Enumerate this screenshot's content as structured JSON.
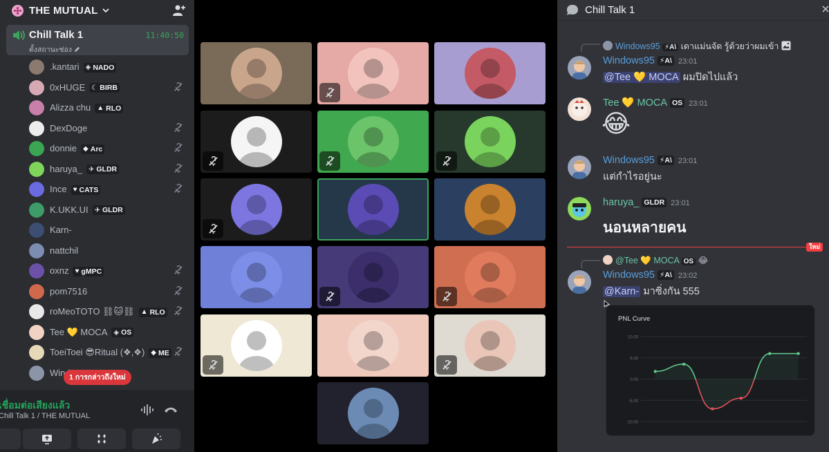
{
  "server": {
    "name": "THE MUTUAL"
  },
  "active_channel": {
    "name": "Chill Talk 1",
    "status": "ตั้งสถานะช่อง",
    "timer": "11:40:50"
  },
  "members": [
    {
      "name": ".kantari",
      "tag": "NADO",
      "glyph": "◈",
      "muted": false,
      "color": "#8a7a70"
    },
    {
      "name": "0xHUGE",
      "tag": "BIRB",
      "glyph": "☾",
      "muted": true,
      "color": "#d7a9b5"
    },
    {
      "name": "Alizza chu",
      "tag": "RLO",
      "glyph": "▲",
      "muted": false,
      "color": "#c87fa9"
    },
    {
      "name": "DexDoge",
      "tag": "",
      "glyph": "",
      "muted": true,
      "color": "#ececec"
    },
    {
      "name": "donnie",
      "tag": "Arc",
      "glyph": "◆",
      "muted": true,
      "color": "#3aa654"
    },
    {
      "name": "haruya_",
      "tag": "GLDR",
      "glyph": "✈",
      "muted": true,
      "color": "#7fd45b"
    },
    {
      "name": "Ince",
      "tag": "CATS",
      "glyph": "♥",
      "muted": true,
      "color": "#6a6be0"
    },
    {
      "name": "K.UKK.UI",
      "tag": "GLDR",
      "glyph": "✈",
      "muted": false,
      "color": "#3d9c68"
    },
    {
      "name": "Karn-",
      "tag": "",
      "glyph": "",
      "muted": false,
      "color": "#3c4f73"
    },
    {
      "name": "nattchil",
      "tag": "",
      "glyph": "",
      "muted": false,
      "color": "#7d8cb3"
    },
    {
      "name": "oxnz",
      "tag": "gMPC",
      "glyph": "♥",
      "muted": true,
      "color": "#6b52a8"
    },
    {
      "name": "pom7516",
      "tag": "",
      "glyph": "",
      "muted": true,
      "color": "#d0694c"
    },
    {
      "name": "roMeoTOTO ⛓🐱⛓",
      "tag": "RLO",
      "glyph": "▲",
      "muted": true,
      "color": "#e8e8e8"
    },
    {
      "name": "Tee 💛 MOCA",
      "tag": "OS",
      "glyph": "◈",
      "muted": false,
      "color": "#f0d3c4"
    },
    {
      "name": "ToeiToei 😎Ritual (❖,❖)",
      "tag": "ME",
      "glyph": "◆",
      "muted": true,
      "color": "#e5d9b8"
    },
    {
      "name": "Windows95",
      "tag": "",
      "glyph": "",
      "muted": false,
      "color": "#8c94a8"
    }
  ],
  "mention_pill": "1 การกล่าวถึงใหม่",
  "voice": {
    "status": "เชื่อมต่อเสียงแล้ว",
    "channel": "Chill Talk 1 / THE MUTUAL"
  },
  "tiles": [
    {
      "bg": "#7a6a58",
      "avatar": "#c9a58c",
      "muted": false,
      "speaking": false
    },
    {
      "bg": "#e5aaa6",
      "avatar": "#f2c3bd",
      "muted": true,
      "speaking": false
    },
    {
      "bg": "#a89dd0",
      "avatar": "#c45a66",
      "muted": false,
      "speaking": false
    },
    {
      "bg": "#1c1c1c",
      "avatar": "#f5f5f5",
      "muted": true,
      "speaking": false
    },
    {
      "bg": "#40a84e",
      "avatar": "#6bc36a",
      "muted": true,
      "speaking": false
    },
    {
      "bg": "#26392c",
      "avatar": "#7ad35c",
      "muted": true,
      "speaking": false
    },
    {
      "bg": "#1c1c1c",
      "avatar": "#7d76e0",
      "muted": true,
      "speaking": false
    },
    {
      "bg": "#24384a",
      "avatar": "#5b4bb5",
      "muted": false,
      "speaking": true
    },
    {
      "bg": "#2b4060",
      "avatar": "#c9822e",
      "muted": false,
      "speaking": false
    },
    {
      "bg": "#6f80d8",
      "avatar": "#7d8ee8",
      "muted": false,
      "speaking": false
    },
    {
      "bg": "#463a78",
      "avatar": "#3b2e6b",
      "muted": true,
      "speaking": false
    },
    {
      "bg": "#d06e52",
      "avatar": "#e07c5d",
      "muted": true,
      "speaking": false
    },
    {
      "bg": "#efe8d5",
      "avatar": "#ffffff",
      "muted": true,
      "speaking": false
    },
    {
      "bg": "#f0c9bd",
      "avatar": "#f2d5cb",
      "muted": false,
      "speaking": false
    },
    {
      "bg": "#e0dbd2",
      "avatar": "#eac6b8",
      "muted": true,
      "speaking": false
    },
    {
      "bg": "#22222e",
      "avatar": "#6b8bb5",
      "muted": false,
      "speaking": false
    }
  ],
  "chat": {
    "title": "Chill Talk 1",
    "new_label": "ใหม่",
    "messages": {
      "m1": {
        "reply_name": "Windows95",
        "reply_tag": "⚡A\\",
        "reply_text": "เดาแม่นจัด รู้ด้วยว่าผมเข้า",
        "user": "Windows95",
        "tag": "⚡A\\",
        "time": "23:01",
        "mention": "@Tee 💛 MOCA",
        "text": "ผมปิดไปแล้ว"
      },
      "m2": {
        "user": "Tee 💛 MOCA",
        "tag": "OS",
        "time": "23:01",
        "emoji": "😂"
      },
      "m3": {
        "user": "Windows95",
        "tag": "⚡A\\",
        "time": "23:01",
        "text": "แต่กำไรอยู่นะ"
      },
      "m4": {
        "user": "haruya_",
        "tag": "GLDR",
        "time": "23:01",
        "text": "นอนหลายคน"
      },
      "m5": {
        "reply_name": "@Tee 💛 MOCA",
        "reply_tag": "OS",
        "reply_text": "😂",
        "user": "Windows95",
        "tag": "⚡A\\",
        "time": "23:02",
        "mention": "@Karn-",
        "text": "มาซิ่งกัน 555"
      }
    },
    "colors": {
      "windows95": "#5b9dd9",
      "tee": "#6bc6a3",
      "haruya": "#6bc6a3"
    }
  },
  "chart_data": {
    "type": "line",
    "title": "PNL Curve",
    "x": [
      1,
      2,
      3,
      4,
      5,
      6
    ],
    "y": [
      1.8,
      3.5,
      -7.0,
      -4.5,
      6.0,
      6.0
    ],
    "ylim": [
      -10,
      10
    ],
    "yticks": [
      "10.00",
      "5.00",
      "0.00",
      "-5.00",
      "-10.00"
    ],
    "positive_color": "#5fc98a",
    "negative_color": "#e0525a"
  }
}
